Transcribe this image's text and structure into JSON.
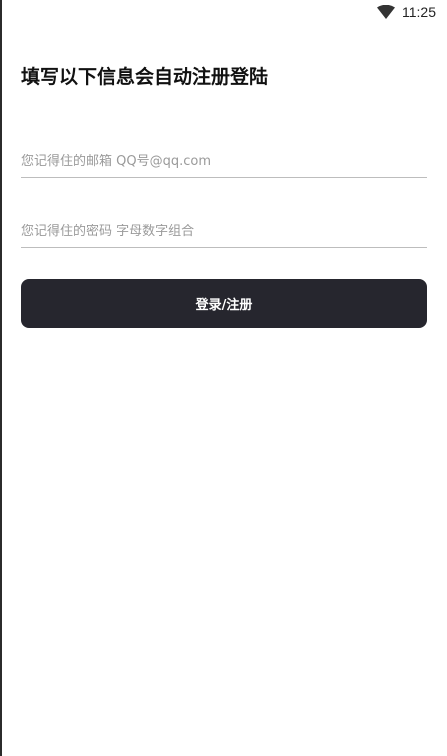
{
  "status_bar": {
    "time": "11:25",
    "wifi_icon": "wifi-icon"
  },
  "form": {
    "title": "填写以下信息会自动注册登陆",
    "email_placeholder": "您记得住的邮箱 QQ号@qq.com",
    "email_value": "",
    "password_placeholder": "您记得住的密码 字母数字组合",
    "password_value": "",
    "submit_label": "登录/注册"
  },
  "colors": {
    "button_background": "#26262e",
    "button_text": "#ffffff",
    "divider": "#bdbdbd",
    "placeholder": "#9a9a9a"
  }
}
